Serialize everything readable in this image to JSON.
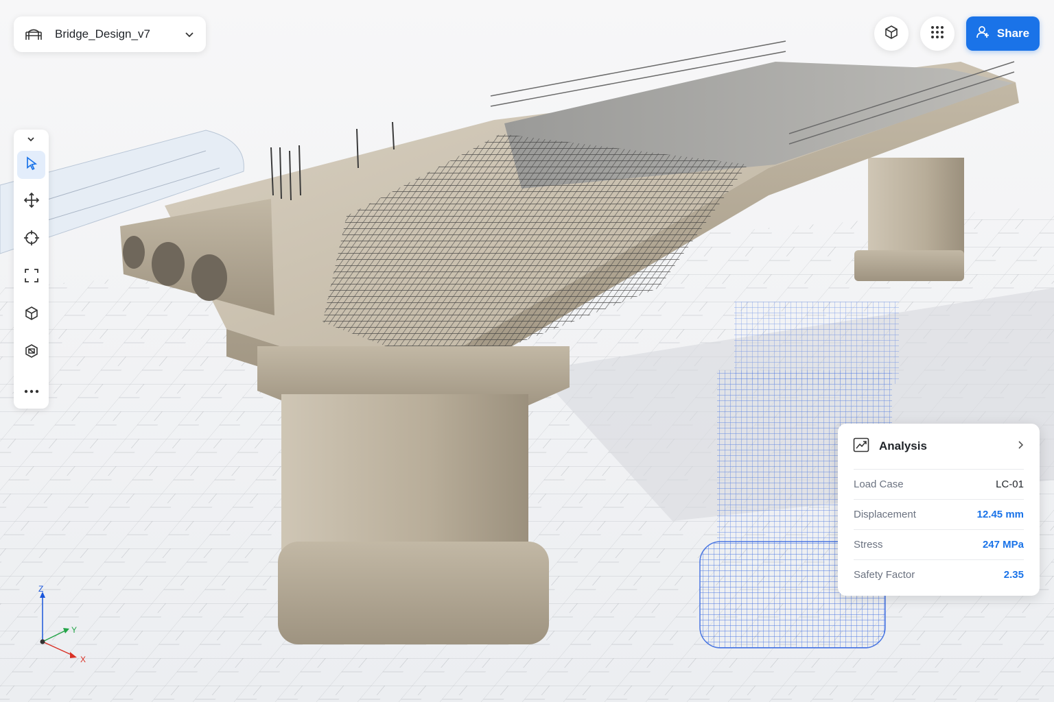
{
  "file": {
    "name": "Bridge_Design_v7",
    "icon": "bridge-icon"
  },
  "header_actions": {
    "view_cube_icon": "cube-icon",
    "apps_icon": "grid-icon",
    "share_label": "Share",
    "share_icon": "user-icon"
  },
  "toolbar": {
    "collapse_icon": "chevron-down-icon",
    "tools": [
      {
        "name": "select",
        "icon": "cursor-icon",
        "active": true
      },
      {
        "name": "move",
        "icon": "move-icon",
        "active": false
      },
      {
        "name": "snap",
        "icon": "crosshair-icon",
        "active": false
      },
      {
        "name": "frame",
        "icon": "frame-icon",
        "active": false
      },
      {
        "name": "box",
        "icon": "cube-icon",
        "active": false
      },
      {
        "name": "section",
        "icon": "section-icon",
        "active": false
      },
      {
        "name": "more",
        "icon": "more-icon",
        "active": false
      }
    ]
  },
  "analysis": {
    "title": "Analysis",
    "rows": [
      {
        "label": "Load Case",
        "value": "LC-01",
        "highlight": false
      },
      {
        "label": "Displacement",
        "value": "12.45 mm",
        "highlight": true
      },
      {
        "label": "Stress",
        "value": "247 MPa",
        "highlight": true
      },
      {
        "label": "Safety Factor",
        "value": "2.35",
        "highlight": true
      }
    ]
  },
  "axes": {
    "z": "Z",
    "y": "Y",
    "x": "X"
  },
  "colors": {
    "accent": "#1a73e8",
    "concrete": "#c9bfae",
    "rebar": "#4a4a4a",
    "wireframe": "#2f63e0",
    "axis_z": "#1a56db",
    "axis_y": "#22a447",
    "axis_x": "#d93025"
  }
}
